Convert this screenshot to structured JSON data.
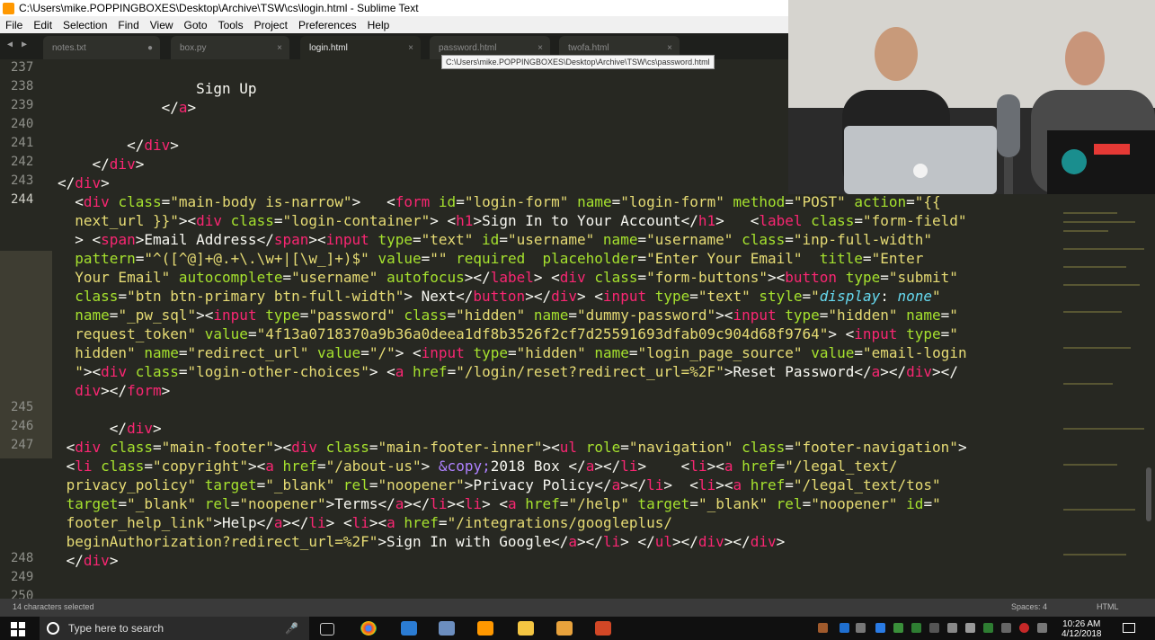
{
  "window_title": "C:\\Users\\mike.POPPINGBOXES\\Desktop\\Archive\\TSW\\cs\\login.html - Sublime Text",
  "menu": [
    "File",
    "Edit",
    "Selection",
    "Find",
    "View",
    "Goto",
    "Tools",
    "Project",
    "Preferences",
    "Help"
  ],
  "tabs": [
    {
      "label": "notes.txt",
      "state": "dirty"
    },
    {
      "label": "box.py",
      "state": "close"
    },
    {
      "label": "login.html",
      "state": "active"
    },
    {
      "label": "password.html",
      "state": "close"
    },
    {
      "label": "twofa.html",
      "state": "close"
    }
  ],
  "tab_dirty_symbol": "●",
  "tab_close_symbol": "×",
  "tooltip": "C:\\Users\\mike.POPPINGBOXES\\Desktop\\Archive\\TSW\\cs\\password.html",
  "line_numbers": [
    "237",
    "238",
    "239",
    "240",
    "241",
    "242",
    "243",
    "244",
    "245",
    "246",
    "247",
    "248",
    "249",
    "250"
  ],
  "current_line": "244",
  "status": {
    "selection": "14 characters selected",
    "spaces": "Spaces: 4",
    "syntax": "HTML"
  },
  "taskbar": {
    "search_placeholder": "Type here to search",
    "time": "10:26 AM",
    "date": "4/12/2018"
  },
  "colors": {
    "editor_bg": "#272822",
    "tag": "#f92672",
    "attr": "#a6e22e",
    "string": "#e6db74",
    "text": "#f8f8f2",
    "css_prop": "#66d9ef",
    "entity": "#ae81ff"
  }
}
